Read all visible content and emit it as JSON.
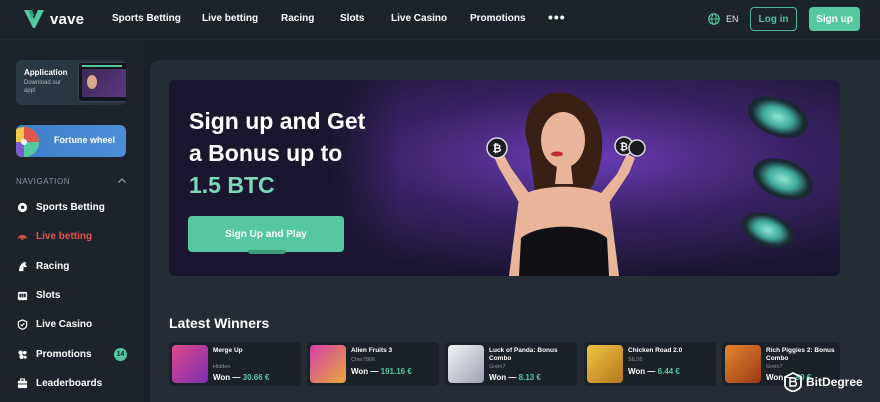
{
  "brand": {
    "name": "vave",
    "accent": "#56c8a0"
  },
  "topnav": {
    "items": [
      "Sports Betting",
      "Live betting",
      "Racing",
      "Slots",
      "Live Casino",
      "Promotions"
    ],
    "more": "•••",
    "lang": "EN",
    "login": "Log in",
    "signup": "Sign up"
  },
  "sidebar": {
    "app": {
      "title": "Application",
      "sub": "Download our app!"
    },
    "fortune": "Fortune wheel",
    "nav_heading": "NAVIGATION",
    "items": [
      {
        "label": "Sports Betting",
        "icon": "soccer-ball-icon"
      },
      {
        "label": "Live betting",
        "icon": "live-icon"
      },
      {
        "label": "Racing",
        "icon": "horse-icon"
      },
      {
        "label": "Slots",
        "icon": "slots-icon"
      },
      {
        "label": "Live Casino",
        "icon": "cards-icon"
      },
      {
        "label": "Promotions",
        "icon": "gift-icon"
      },
      {
        "label": "Leaderboards",
        "icon": "trophy-icon"
      }
    ],
    "promotions_badge": "14"
  },
  "hero": {
    "title_line1": "Sign up and Get",
    "title_line2": "a Bonus up to",
    "title_accent": "1.5 BTC",
    "cta": "Sign Up and Play"
  },
  "winners": {
    "title": "Latest Winners",
    "items": [
      {
        "game": "Merge Up",
        "user": "Hidden",
        "won": "Won —",
        "amount": "30.66 €",
        "thumb": "#d43a7a"
      },
      {
        "game": "Alien Fruits 3",
        "user": "Cher7866",
        "won": "Won —",
        "amount": "191.16 €",
        "thumb": "#c23ea8"
      },
      {
        "game": "Luck of Panda: Bonus Combo",
        "user": "Grein7",
        "won": "Won —",
        "amount": "8.13 €",
        "thumb": "#e9e9ee"
      },
      {
        "game": "Chicken Road 2.0",
        "user": "SIL06",
        "won": "Won —",
        "amount": "6.44 €",
        "thumb": "#e0b33c"
      },
      {
        "game": "Rich Piggies 2: Bonus Combo",
        "user": "Grein7",
        "won": "Won —",
        "amount": "89 €",
        "thumb": "#d9772a"
      }
    ]
  },
  "watermark": "BitDegree"
}
